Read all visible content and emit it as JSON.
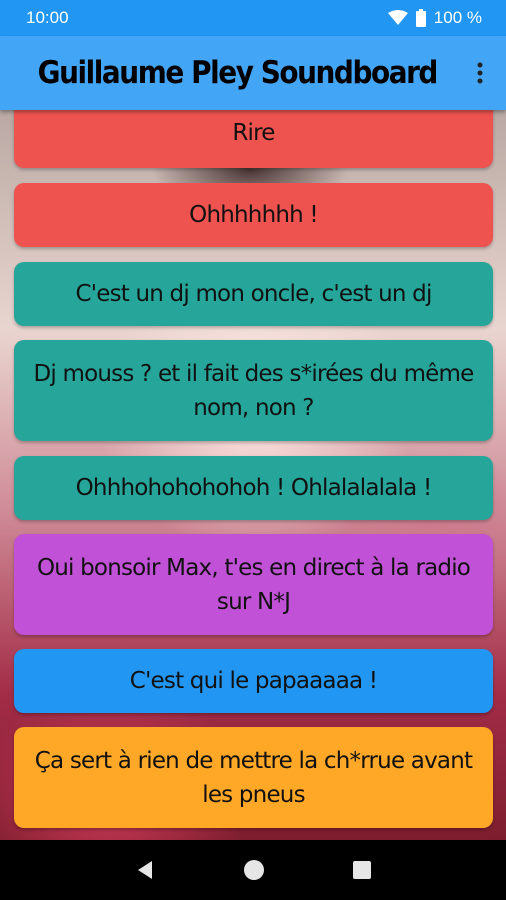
{
  "status_bar": {
    "time": "10:00",
    "battery": "100 %"
  },
  "app_bar": {
    "title": "Guillaume Pley Soundboard",
    "overflow_icon": "more-vert-icon"
  },
  "colors": {
    "red": "#ef5350",
    "teal": "#26a69a",
    "purple": "#c151d6",
    "blue": "#2196f3",
    "orange": "#ffa726",
    "appbar": "#42a5f5",
    "statusbar": "#2196f3"
  },
  "sounds": [
    {
      "label": "Rire",
      "color": "#ef5350"
    },
    {
      "label": "Ohhhhhhh !",
      "color": "#ef5350"
    },
    {
      "label": "C'est un dj mon oncle, c'est un dj",
      "color": "#26a69a"
    },
    {
      "label": "Dj mouss ? et il fait des s*irées du même nom, non ?",
      "color": "#26a69a"
    },
    {
      "label": "Ohhhohohohohoh ! Ohlalalalala !",
      "color": "#26a69a"
    },
    {
      "label": "Oui bonsoir Max, t'es en direct à la radio sur N*J",
      "color": "#c151d6"
    },
    {
      "label": "C'est qui le papaaaaa !",
      "color": "#2196f3"
    },
    {
      "label": "Ça sert à rien de mettre la ch*rrue avant les pneus",
      "color": "#ffa726"
    }
  ],
  "nav_bar": {
    "back": "back-icon",
    "home": "home-icon",
    "recents": "recents-icon"
  }
}
